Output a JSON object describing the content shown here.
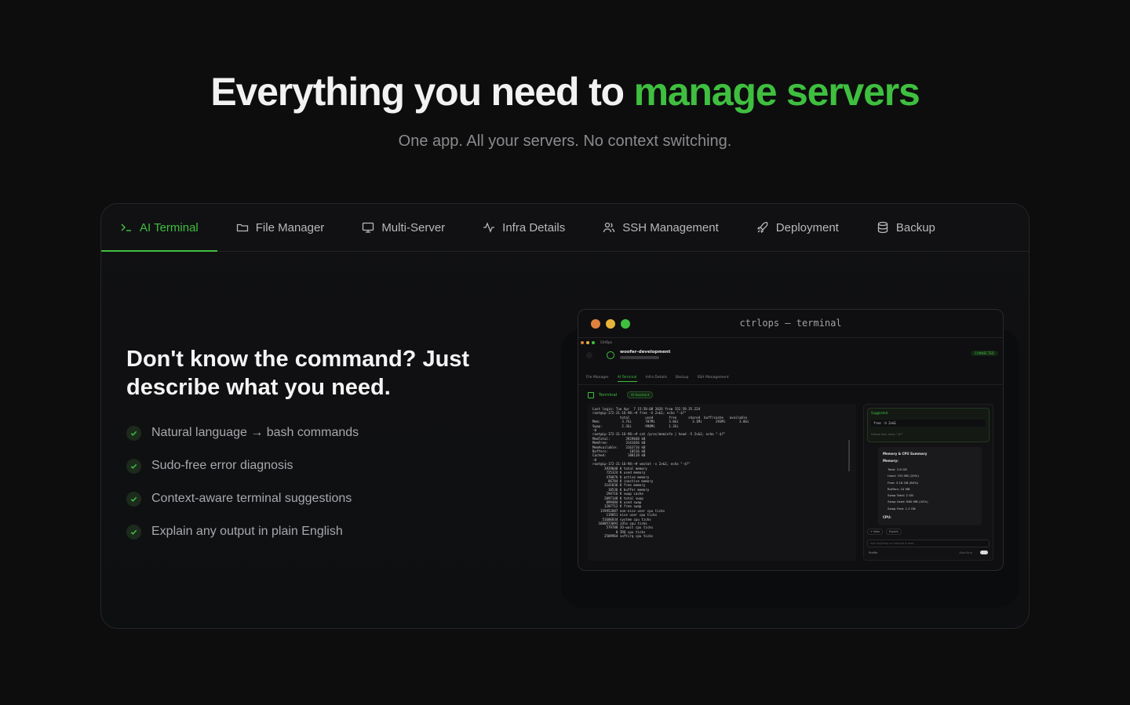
{
  "hero": {
    "title_prefix": "Everything you need to ",
    "title_accent": "manage servers",
    "subtitle": "One app. All your servers. No context switching."
  },
  "tabs": [
    {
      "label": "AI Terminal",
      "icon": "terminal-icon",
      "active": true
    },
    {
      "label": "File Manager",
      "icon": "folder-icon"
    },
    {
      "label": "Multi-Server",
      "icon": "monitor-icon"
    },
    {
      "label": "Infra Details",
      "icon": "activity-icon"
    },
    {
      "label": "SSH Management",
      "icon": "users-icon"
    },
    {
      "label": "Deployment",
      "icon": "rocket-icon"
    },
    {
      "label": "Backup",
      "icon": "database-icon"
    }
  ],
  "feature": {
    "heading": "Don't know the command? Just describe what you need.",
    "items": [
      "Natural language → bash commands",
      "Sudo-free error diagnosis",
      "Context-aware terminal suggestions",
      "Explain any output in plain English"
    ]
  },
  "window": {
    "title": "ctrlops — terminal",
    "app_name": "CtrlOps",
    "server_name": "woofer-development",
    "status": "CONNECTED",
    "inner_tabs": [
      "File Manager",
      "AI Terminal",
      "Infra Details",
      "Backup",
      "SSH Management"
    ],
    "terminal_label": "Terminal",
    "ai_badge": "AI Assistant",
    "terminal_lines": [
      "Last login: Tue Apr  7 15:58:08 2026 from 152.59.35.224",
      "root@ip-172-31-16-98:~# free -h 2>&1; echo \"-$?\"",
      "              total        used        free      shared  buff/cache   available",
      "Mem:           3.7Gi       707Mi       3.0Gi       3.1Mi       293Mi       3.0Gi",
      "Swap:          2.3Gi       998Mi       1.3Gi",
      "-0",
      "root@ip-172-31-16-98:~# cat /proc/meminfo | head -5 2>&1; echo \"-$?\"",
      "MemTotal:        3929048 kB",
      "MemFree:         3141836 kB",
      "MemAvailable:    3163716 kB",
      "Buffers:           10516 kB",
      "Cached:           188128 kB",
      "-0",
      "root@ip-172-31-16-98:~# vmstat -s 2>&1; echo \"-$?\"",
      "      3929048 K total memory",
      "       725324 K used memory",
      "       470076 K active memory",
      "        86784 K inactive memory",
      "      3141836 K free memory",
      "        10536 K buffer memory",
      "       294716 K swap cache",
      "      2097148 K total swap",
      "       899484 K used swap",
      "      1207712 K free swap",
      "    159952887 non-nice user cpu ticks",
      "       119851 nice user cpu ticks",
      "     51606834 system cpu ticks",
      "   1600573093 idle cpu ticks",
      "       579788 IO-wait cpu ticks",
      "            0 IRQ cpu ticks",
      "      3509964 softirq cpu ticks"
    ],
    "ai_panel": {
      "suggestion_title": "Suggested",
      "suggestion_cmd": "free -h 2>&1",
      "suggestion_note": "Follow-free, echo \"-$?\"",
      "summary_title": "Memory & CPU Summary",
      "memory_label": "Memory:",
      "stats": [
        "Total: 3.8 GB",
        "Used: 755 MB (20%)",
        "Free: 3.16 GB (80%)",
        "Buffers: 10 MB",
        "Swap Total: 2 GB",
        "Swap Used: 880 MB (42%)",
        "Swap Free: 1.2 GB"
      ],
      "cpu_label": "CPU:",
      "new_label": "+ New",
      "expert_label": "Expert",
      "input_placeholder": "Ask anything or request a task...",
      "profile_label": "Profile",
      "auto_run_label": "Auto-Run"
    }
  },
  "colors": {
    "accent": "#3fbf3f",
    "dot_red": "#e0823d",
    "dot_yellow": "#e8b339",
    "dot_green": "#3fbf3f"
  }
}
